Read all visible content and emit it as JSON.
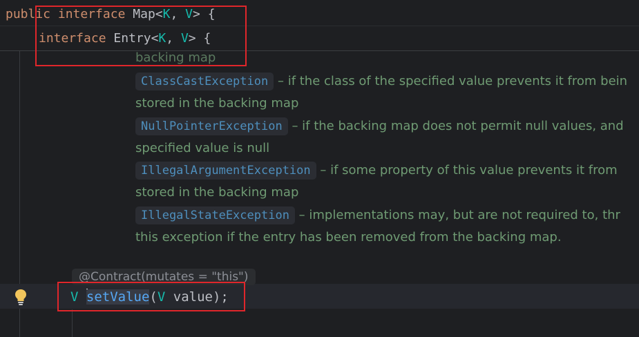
{
  "sticky": {
    "line1": {
      "kw1": "public",
      "kw2": "interface",
      "name": "Map",
      "k": "K",
      "v": "V",
      "open": "{"
    },
    "line2": {
      "kw": "interface",
      "name": "Entry",
      "k": "K",
      "v": "V",
      "open": "{"
    }
  },
  "doc": {
    "first_line": "backing map",
    "items": [
      {
        "exception": "ClassCastException",
        "text": "– if the class of the specified value prevents it from bein",
        "cont": "stored in the backing map"
      },
      {
        "exception": "NullPointerException",
        "text": "– if the backing map does not permit null values, and",
        "cont": "specified value is null"
      },
      {
        "exception": "IllegalArgumentException",
        "text": "– if some property of this value prevents it from",
        "cont": "stored in the backing map"
      },
      {
        "exception": "IllegalStateException",
        "text": "– implementations may, but are not required to, thr",
        "cont": "this exception if the entry has been removed from the backing map."
      }
    ]
  },
  "annotation": "@Contract(mutates = \"this\")",
  "code": {
    "type": "V",
    "method": "setValue",
    "param_type": "V",
    "param": "value",
    "end": ");"
  },
  "colors": {
    "keyword": "#cf8e6d",
    "type_param": "#16baac",
    "method": "#56a8f5",
    "doc_text": "#6f9b73",
    "link": "#4e8fbd",
    "highlight": "#e0262b"
  },
  "icons": {
    "intention": "lightbulb-icon"
  }
}
